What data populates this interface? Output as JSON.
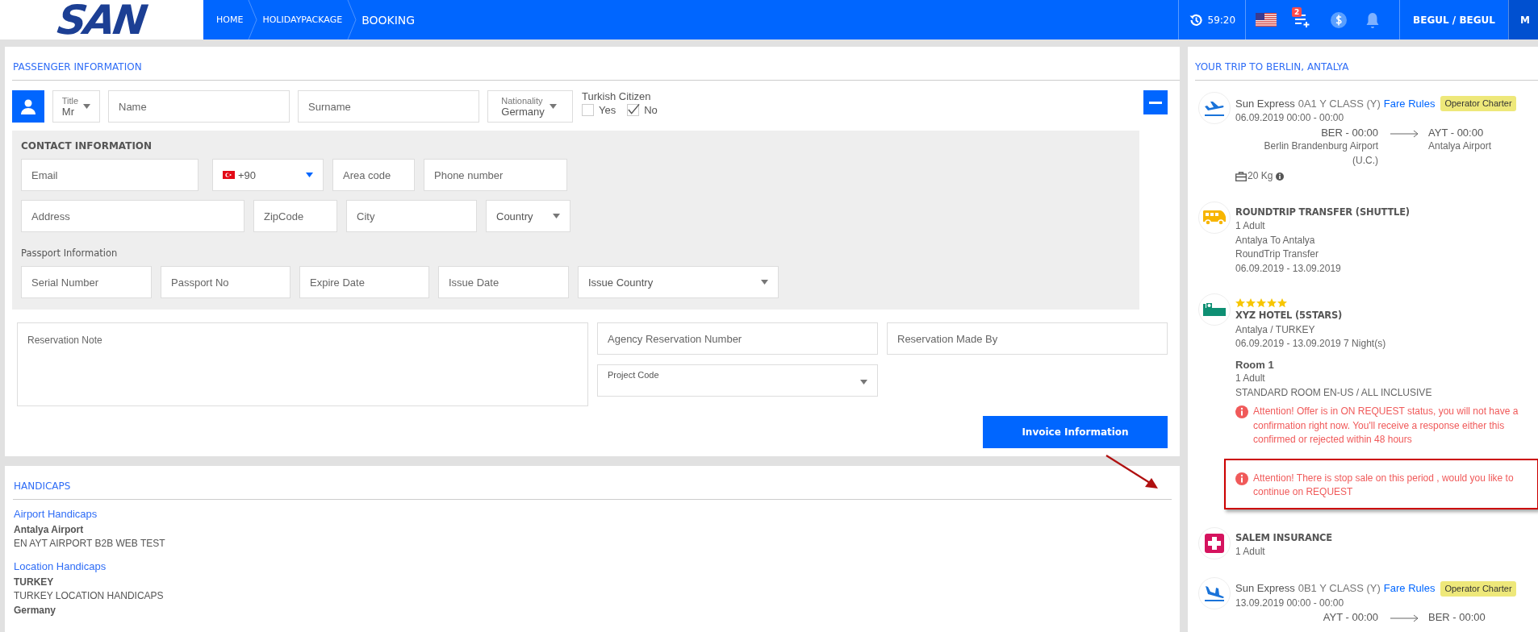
{
  "header": {
    "logo": "SAN",
    "breadcrumbs": [
      {
        "label": "HOME",
        "current": false
      },
      {
        "label": "HOLIDAYPACKAGE",
        "current": false
      },
      {
        "label": "BOOKING",
        "current": true
      }
    ],
    "timer": "59:20",
    "cart_count": "2",
    "user": "BEGUL / BEGUL",
    "menu": "M"
  },
  "passenger": {
    "title": "PASSENGER INFORMATION",
    "expanded": true,
    "title_select": {
      "label": "Title",
      "value": "Mr"
    },
    "name": {
      "placeholder": "Name"
    },
    "surname": {
      "placeholder": "Surname"
    },
    "nationality": {
      "label": "Nationality",
      "value": "Germany"
    },
    "turkish_citizen": {
      "label": "Turkish Citizen",
      "options": [
        {
          "label": "Yes",
          "checked": false
        },
        {
          "label": "No",
          "checked": true
        }
      ]
    },
    "contact": {
      "title": "CONTACT INFORMATION",
      "rows": [
        [
          {
            "kind": "input",
            "placeholder": "Email"
          },
          {
            "kind": "phone",
            "value": "+90"
          },
          {
            "kind": "input",
            "placeholder": "Area code"
          },
          {
            "kind": "input",
            "placeholder": "Phone number"
          }
        ],
        [
          {
            "kind": "input",
            "placeholder": "Address"
          },
          {
            "kind": "input",
            "placeholder": "ZipCode"
          },
          {
            "kind": "input",
            "placeholder": "City"
          },
          {
            "kind": "select",
            "placeholder": "Country"
          }
        ]
      ]
    },
    "passport": {
      "title": "Passport Information",
      "fields": [
        {
          "kind": "input",
          "placeholder": "Serial Number"
        },
        {
          "kind": "input",
          "placeholder": "Passport No"
        },
        {
          "kind": "input",
          "placeholder": "Expire Date"
        },
        {
          "kind": "input",
          "placeholder": "Issue Date"
        },
        {
          "kind": "select",
          "placeholder": "Issue Country"
        }
      ]
    },
    "reservation_note": {
      "placeholder": "Reservation Note"
    },
    "agency_reservation_number": {
      "placeholder": "Agency Reservation Number"
    },
    "reservation_made_by": {
      "placeholder": "Reservation Made By"
    },
    "project_code": {
      "label": "Project Code"
    },
    "invoice_button": "Invoice Information"
  },
  "handicaps": {
    "title": "HANDICAPS",
    "groups": [
      {
        "title": "Airport Handicaps",
        "entries": [
          {
            "name": "Antalya Airport",
            "detail": "EN AYT AIRPORT B2B WEB TEST"
          }
        ]
      },
      {
        "title": "Location Handicaps",
        "entries": [
          {
            "name": "TURKEY",
            "detail": "TURKEY LOCATION HANDICAPS"
          },
          {
            "name": "Germany"
          }
        ]
      }
    ]
  },
  "trip": {
    "title": "YOUR TRIP TO BERLIN, ANTALYA",
    "items": [
      {
        "kind": "outbound_flight",
        "airline": "Sun Express",
        "flight_class": "0A1 Y CLASS (Y)",
        "fare_rules": "Fare Rules",
        "badge": "Operator Charter",
        "date": "06.09.2019 00:00 - 00:00",
        "from": {
          "time": "BER - 00:00",
          "airport": "Berlin Brandenburg Airport (U.C.)"
        },
        "to": {
          "time": "AYT - 00:00",
          "airport": "Antalya Airport"
        },
        "baggage": "20 Kg"
      },
      {
        "kind": "transfer",
        "name": "ROUNDTRIP TRANSFER (SHUTTLE)",
        "details": [
          "1 Adult",
          "Antalya To Antalya",
          "RoundTrip Transfer",
          "06.09.2019 - 13.09.2019"
        ]
      },
      {
        "kind": "hotel",
        "stars": 5,
        "name": "XYZ HOTEL (5STARS)",
        "details": [
          "Antalya / TURKEY",
          "06.09.2019 - 13.09.2019 7 Night(s)"
        ],
        "room": "Room 1",
        "room_details": [
          "1 Adult",
          "STANDARD ROOM EN-US / ALL INCLUSIVE"
        ],
        "alerts": [
          {
            "text": "Attention! Offer is in ON REQUEST status, you will not have a confirmation right now. You'll receive a response either this confirmed or rejected within 48 hours",
            "highlighted": false
          },
          {
            "text": "Attention! There is stop sale on this period , would you like to continue on REQUEST",
            "highlighted": true
          }
        ]
      },
      {
        "kind": "insurance",
        "name": "SALEM INSURANCE",
        "details": [
          "1 Adult"
        ]
      },
      {
        "kind": "return_flight",
        "airline": "Sun Express",
        "flight_class": "0B1 Y CLASS (Y)",
        "fare_rules": "Fare Rules",
        "badge": "Operator Charter",
        "date": "13.09.2019 00:00 - 00:00",
        "from": {
          "time": "AYT - 00:00"
        },
        "to": {
          "time": "BER - 00:00"
        }
      }
    ]
  }
}
